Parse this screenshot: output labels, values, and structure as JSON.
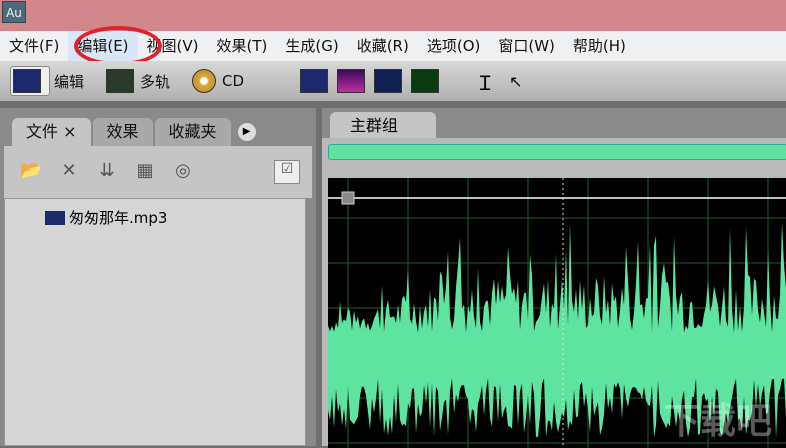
{
  "app_icon": "Au",
  "menu": [
    "文件(F)",
    "编辑(E)",
    "视图(V)",
    "效果(T)",
    "生成(G)",
    "收藏(R)",
    "选项(O)",
    "窗口(W)",
    "帮助(H)"
  ],
  "toolbar": {
    "edit": "编辑",
    "multitrack": "多轨",
    "cd": "CD"
  },
  "left_panel": {
    "tabs": [
      "文件",
      "效果",
      "收藏夹"
    ],
    "close": "×",
    "files": [
      "匆匆那年.mp3"
    ]
  },
  "main_panel": {
    "tab": "主群组"
  },
  "watermark": "下载吧",
  "colors": {
    "title": "#d0868b",
    "wave": "#5fe3a0",
    "highlight": "#e2222a"
  }
}
